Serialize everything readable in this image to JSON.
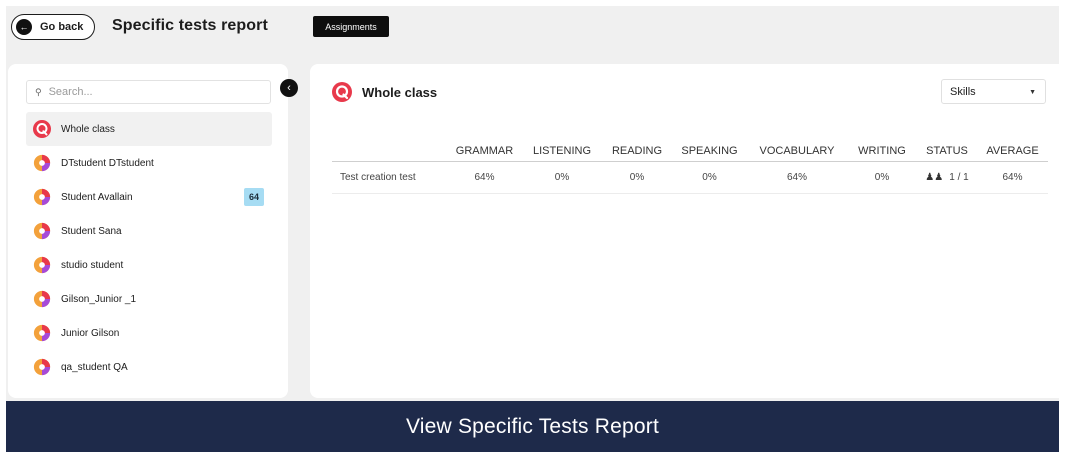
{
  "header": {
    "go_back": "Go back",
    "title": "Specific tests report",
    "assignments": "Assignments"
  },
  "sidebar": {
    "search_placeholder": "Search...",
    "items": [
      {
        "label": "Whole class",
        "active": true
      },
      {
        "label": "DTstudent DTstudent"
      },
      {
        "label": "Student Avallain",
        "badge": "64"
      },
      {
        "label": "Student Sana"
      },
      {
        "label": "studio student"
      },
      {
        "label": "Gilson_Junior _1"
      },
      {
        "label": "Junior Gilson"
      },
      {
        "label": "qa_student QA"
      }
    ]
  },
  "main": {
    "title": "Whole class",
    "skills_select": "Skills",
    "columns": [
      "",
      "GRAMMAR",
      "LISTENING",
      "READING",
      "SPEAKING",
      "VOCABULARY",
      "WRITING",
      "STATUS",
      "AVERAGE"
    ],
    "rows": [
      {
        "name": "Test creation test",
        "grammar": "64%",
        "listening": "0%",
        "reading": "0%",
        "speaking": "0%",
        "vocabulary": "64%",
        "writing": "0%",
        "status": "1 / 1",
        "average": "64%"
      }
    ]
  },
  "banner": "View Specific Tests Report",
  "colors": {
    "brand_red": "#e8394b",
    "banner_bg": "#1e2a4a",
    "badge_bg": "#a6dcf3"
  }
}
